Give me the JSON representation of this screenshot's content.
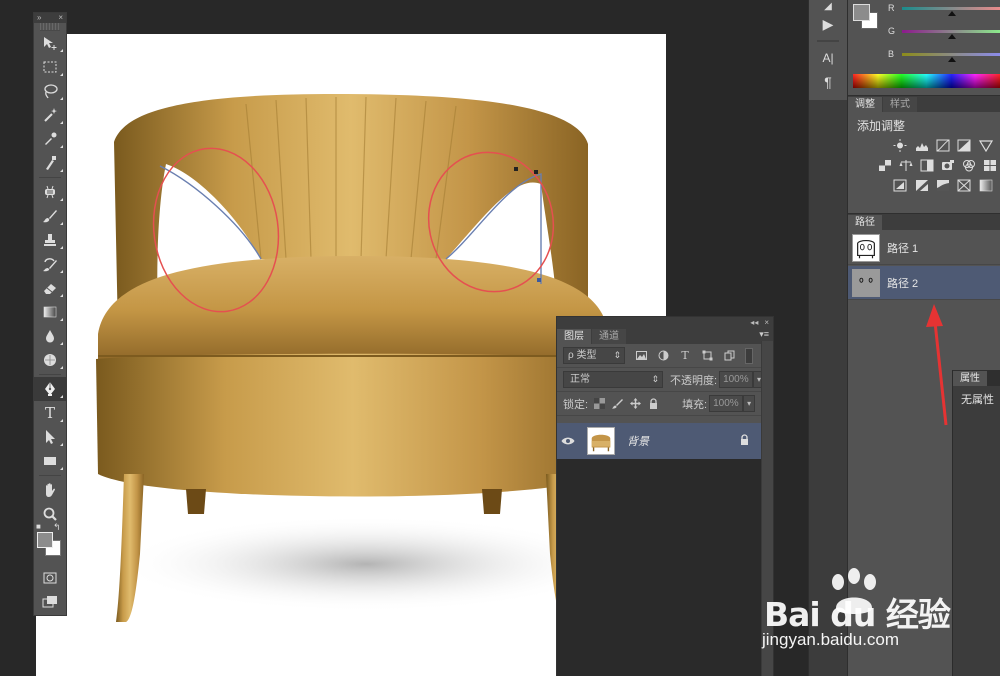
{
  "tools_panel": {
    "header_left": "»",
    "header_right": "×",
    "tools": [
      {
        "name": "move-tool",
        "icon": "move-icon"
      },
      {
        "name": "marquee-tool",
        "icon": "rect-marquee-icon"
      },
      {
        "name": "lasso-tool",
        "icon": "lasso-icon"
      },
      {
        "name": "magic-wand-tool",
        "icon": "magic-wand-icon"
      },
      {
        "name": "eyedropper-tool",
        "icon": "eyedropper-icon"
      },
      {
        "name": "ruler-tool",
        "icon": "color-sampler-icon"
      },
      {
        "name": "healing-brush-tool",
        "icon": "healing-icon"
      },
      {
        "name": "brush-tool",
        "icon": "brush-icon"
      },
      {
        "name": "stamp-tool",
        "icon": "stamp-icon"
      },
      {
        "name": "history-brush-tool",
        "icon": "history-brush-icon"
      },
      {
        "name": "eraser-tool",
        "icon": "eraser-icon"
      },
      {
        "name": "gradient-tool",
        "icon": "gradient-icon"
      },
      {
        "name": "blur-tool",
        "icon": "drop-icon"
      },
      {
        "name": "dodge-tool",
        "icon": "dodge-icon"
      },
      {
        "name": "pen-tool",
        "icon": "pen-icon"
      },
      {
        "name": "type-tool",
        "icon": "type-icon"
      },
      {
        "name": "path-selection-tool",
        "icon": "arrow-icon"
      },
      {
        "name": "shape-tool",
        "icon": "rectangle-icon"
      },
      {
        "name": "hand-tool",
        "icon": "hand-icon"
      },
      {
        "name": "zoom-tool",
        "icon": "zoom-icon"
      }
    ],
    "type_glyph": "T",
    "foreground_color": "#8c8c8c",
    "background_color": "#ffffff"
  },
  "mid_strip": {
    "play_glyph": "▶",
    "char_glyph": "A|",
    "para_glyph": "¶"
  },
  "color_panel": {
    "channels": [
      {
        "label": "R",
        "value": 140
      },
      {
        "label": "G",
        "value": 140
      },
      {
        "label": "B",
        "value": 140
      }
    ]
  },
  "adjustments_panel": {
    "tabs": [
      "调整",
      "样式"
    ],
    "title": "添加调整"
  },
  "paths_panel": {
    "tab": "路径",
    "items": [
      {
        "label": "路径 1",
        "selected": false
      },
      {
        "label": "路径 2",
        "selected": true
      }
    ]
  },
  "properties_panel": {
    "tab": "属性",
    "text": "无属性"
  },
  "layers_panel": {
    "header_collapse": "◂◂",
    "header_close": "×",
    "tabs": [
      "图层",
      "通道"
    ],
    "menu_glyph": "▾≡",
    "kind_filter": "ρ 类型",
    "blend_mode": "正常",
    "opacity_label": "不透明度:",
    "opacity_value": "100%",
    "lock_label": "锁定:",
    "fill_label": "填充:",
    "fill_value": "100%",
    "layers": [
      {
        "name": "背景",
        "visible": true,
        "locked": true
      }
    ]
  },
  "watermark": {
    "logo": "Bai du 经验",
    "url": "jingyan.baidu.com"
  },
  "colors": {
    "selection_highlight": "#4e5a74",
    "annotation_red": "#e53333",
    "panel_bg": "#535353"
  }
}
